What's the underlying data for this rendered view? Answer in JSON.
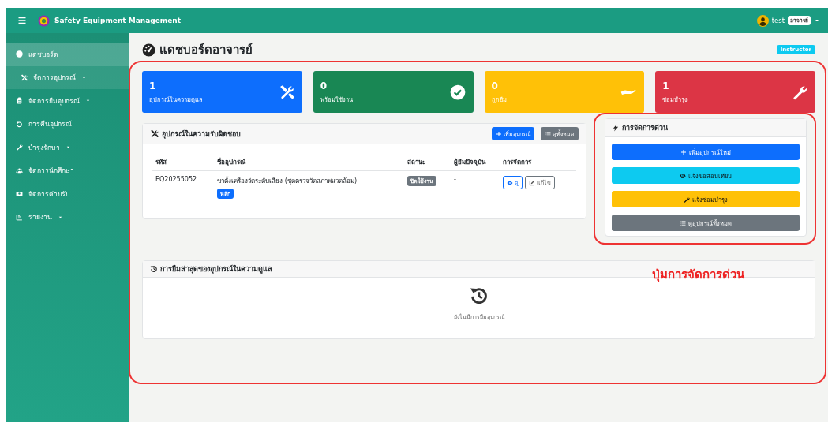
{
  "app": {
    "title": "Safety Equipment Management"
  },
  "user": {
    "name": "test",
    "role": "อาจารย์"
  },
  "sidebar": {
    "items": [
      {
        "label": "แดชบอร์ด",
        "selected": true,
        "hovered": false,
        "dropdown": false
      },
      {
        "label": "จัดการอุปกรณ์",
        "selected": false,
        "hovered": true,
        "dropdown": true
      },
      {
        "label": "จัดการยืมอุปกรณ์",
        "selected": false,
        "hovered": false,
        "dropdown": true
      },
      {
        "label": "การคืนอุปกรณ์",
        "selected": false,
        "hovered": false,
        "dropdown": false
      },
      {
        "label": "บำรุงรักษา",
        "selected": false,
        "hovered": false,
        "dropdown": true
      },
      {
        "label": "จัดการนักศึกษา",
        "selected": false,
        "hovered": false,
        "dropdown": false
      },
      {
        "label": "จัดการค่าปรับ",
        "selected": false,
        "hovered": false,
        "dropdown": false
      },
      {
        "label": "รายงาน",
        "selected": false,
        "hovered": false,
        "dropdown": true
      }
    ]
  },
  "page": {
    "title": "แดชบอร์ดอาจารย์",
    "role_badge": "Instructor"
  },
  "stats": [
    {
      "value": "1",
      "label": "อุปกรณ์ในความดูแล",
      "color": "#0d6efd"
    },
    {
      "value": "0",
      "label": "พร้อมใช้งาน",
      "color": "#198754"
    },
    {
      "value": "0",
      "label": "ถูกยืม",
      "color": "#ffc107"
    },
    {
      "value": "1",
      "label": "ซ่อมบำรุง",
      "color": "#dc3545"
    }
  ],
  "equipment_panel": {
    "title": "อุปกรณ์ในความรับผิดชอบ",
    "buttons": [
      {
        "label": "เพิ่มอุปกรณ์",
        "kind": "primary"
      },
      {
        "label": "ดูทั้งหมด",
        "kind": "secondary"
      }
    ],
    "columns": [
      "รหัส",
      "ชื่ออุปกรณ์",
      "สถานะ",
      "ผู้ยืมปัจจุบัน",
      "การจัดการ"
    ],
    "rows": [
      {
        "code": "EQ20255052",
        "name": "ขาตั้งเครื่องวัดระดับเสียง (ชุดตรวจวัดสภาพแวดล้อม)",
        "tag": "หลัก",
        "status": "ปิดใช้งาน",
        "borrower": "-",
        "actions": [
          {
            "label": "ดู",
            "kind": "view"
          },
          {
            "label": "แก้ไข",
            "kind": "edit"
          }
        ]
      }
    ]
  },
  "quick_actions": {
    "title": "การจัดการด่วน",
    "buttons": [
      {
        "label": "เพิ่มอุปกรณ์ใหม่",
        "kind": "primary"
      },
      {
        "label": "แจ้งขอสอบเทียบ",
        "kind": "info"
      },
      {
        "label": "แจ้งซ่อมบำรุง",
        "kind": "warning"
      },
      {
        "label": "ดูอุปกรณ์ทั้งหมด",
        "kind": "secondary"
      }
    ]
  },
  "recent": {
    "title": "การยืมล่าสุดของอุปกรณ์ในความดูแล",
    "empty_text": "ยังไม่มีการยืมอุปกรณ์"
  },
  "annotation": {
    "label": "ปุ่มการจัดการด่วน"
  }
}
